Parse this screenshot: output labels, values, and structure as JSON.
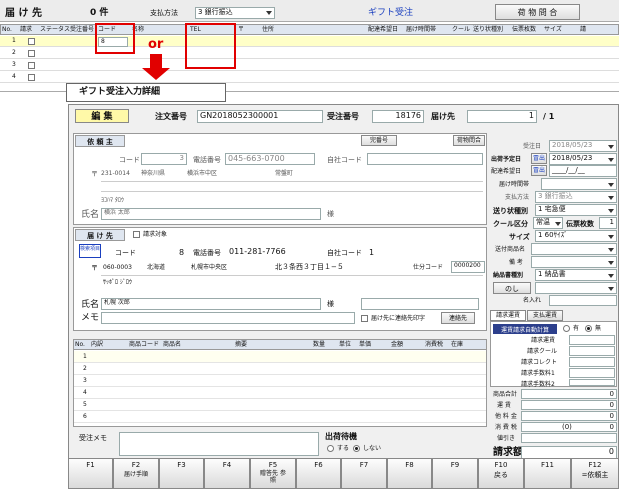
{
  "bg": {
    "delivery_label": "届 け 先",
    "count_value": "0 件",
    "payment_label": "支払方法",
    "payment_value": "3 銀行振込",
    "gift_title": "ギフト受注",
    "baggage_button": "荷 物 問 合",
    "columns": [
      "No.",
      "請求",
      "ステータス",
      "受注番号",
      "コード",
      "名称",
      "TEL",
      "〒",
      "住所",
      "配達希望日",
      "届け時間帯",
      "クール",
      "送り状種別",
      "伝票枚数",
      "サイズ",
      "",
      "請"
    ],
    "rows": [
      "1",
      "2",
      "3",
      "4"
    ],
    "first_code": "8",
    "or_label": "or"
  },
  "detail": {
    "caption": "ギフト受注入力詳細",
    "mode": "編 集",
    "order_no_label": "注文番号",
    "order_no": "GN2018052300001",
    "receipt_no_label": "受注番号",
    "receipt_no": "18176",
    "dest_label": "届け先",
    "dest_no": "1",
    "dest_total": "/ 1",
    "client": {
      "title": "依 頼 主",
      "search_button": "完番号",
      "inquiry_button": "荷物問合",
      "code_label": "コード",
      "code": "3",
      "tel_label": "電話番号",
      "tel": "045-663-0700",
      "own_code_label": "自社コード",
      "zip_label": "〒",
      "zip": "231-0014",
      "pref": "神奈川県",
      "city": "横浜市中区",
      "town": "常盤町",
      "kana": "ﾖｺﾊﾏ ﾀﾛｳ",
      "name_label": "氏名",
      "name": "横浜 太郎",
      "honorific": "様"
    },
    "delivery": {
      "title": "届 け 先",
      "billing_target": "請求対象",
      "search_label": "検索項目",
      "code_label": "コード",
      "code": "8",
      "tel_label": "電話番号",
      "tel": "011-281-7766",
      "own_code_label": "自社コード",
      "own_code": "1",
      "zip_label": "〒",
      "zip": "060-0003",
      "pref": "北海道",
      "city": "札幌市中央区",
      "town": "北３条西３丁目１−５",
      "sort_label": "仕分コード",
      "sort_code": "0000200",
      "kana": "ｻｯﾎﾟﾛ ｼﾞﾛｳ",
      "name_label": "氏名",
      "name": "札幌 次郎",
      "honorific": "様",
      "memo_label": "メモ",
      "notify_label": "届け先に連絡先印字",
      "contact_button": "連絡先"
    },
    "side": {
      "receipt_date_label": "受注日",
      "receipt_date": "2018/05/23",
      "ship_date_label": "出荷予定日",
      "ship_date": "2018/05/23",
      "deliv_date_label": "配達希望日",
      "deliv_date": "____/__/__",
      "cal": "冒出",
      "time_label": "届け時間帯",
      "pay_label": "支払方法",
      "pay": "3 銀行振込",
      "slip_type_label": "送り状種別",
      "slip_type": "1 宅急便",
      "cool_label": "クール区分",
      "cool": "常温",
      "slip_count_label": "伝票枚数",
      "slip_count": "1",
      "size_label": "サイズ",
      "size": "1 60ｻｲｽﾞ",
      "item_label": "送付商品名",
      "note_label": "備 考",
      "doc_label": "納品書種別",
      "doc": "1 納品書",
      "noshi": "のし",
      "nameplate": "名入れ",
      "tab1": "請求運賃",
      "tab2": "支払運賃",
      "auto_calc": "運賃請求自動計算",
      "yes": "有",
      "no": "無",
      "bill_rows": [
        "請求運賃",
        "請求クール",
        "請求コレクト",
        "請求手数料1",
        "請求手数料2"
      ],
      "totals": [
        {
          "label": "商品合計",
          "value": "0"
        },
        {
          "label": "運 賃",
          "value": "0"
        },
        {
          "label": "他 料 金",
          "value": "0"
        },
        {
          "label": "消 費 税",
          "value": "0"
        },
        {
          "label": "値引き",
          "value": ""
        }
      ],
      "tax_paren": "(0)",
      "invoice_label": "請求額",
      "invoice": "0"
    },
    "grid": {
      "columns": [
        "No.",
        "内訳",
        "商品コード",
        "商品名",
        "摘要",
        "数量",
        "単位",
        "単価",
        "金額",
        "消費税",
        "在庫"
      ],
      "rows": [
        "1",
        "2",
        "3",
        "4",
        "5",
        "6"
      ]
    },
    "memo_label": "受注メモ",
    "waiting": {
      "label": "出荷待機",
      "yes": "する",
      "no": "しない"
    },
    "fkeys": [
      {
        "key": "F1",
        "value": ""
      },
      {
        "key": "F2",
        "value": "届け手順"
      },
      {
        "key": "F3",
        "value": ""
      },
      {
        "key": "F4",
        "value": ""
      },
      {
        "key": "F5",
        "value": "贈答先 参照"
      },
      {
        "key": "F6",
        "value": ""
      },
      {
        "key": "F7",
        "value": ""
      },
      {
        "key": "F8",
        "value": ""
      },
      {
        "key": "F9",
        "value": ""
      },
      {
        "key": "F10",
        "value": "戻る"
      },
      {
        "key": "F11",
        "value": ""
      },
      {
        "key": "F12",
        "value": "=依頼主"
      }
    ]
  }
}
